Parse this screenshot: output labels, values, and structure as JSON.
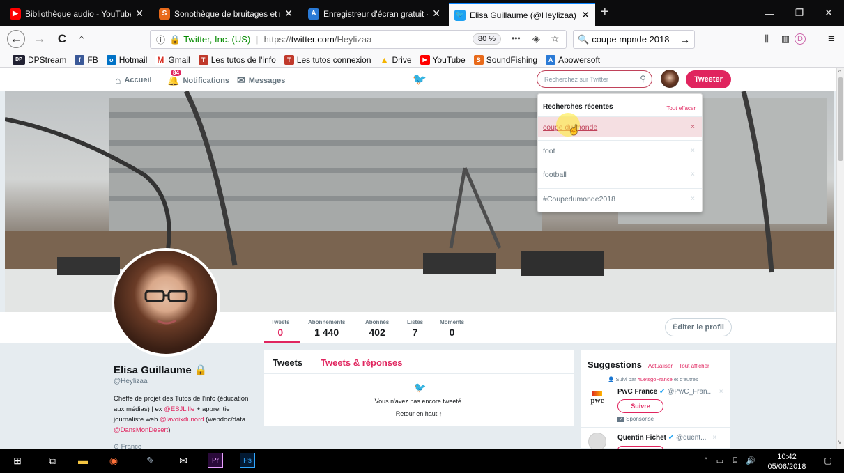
{
  "browser": {
    "tabs": [
      {
        "label": "Bibliothèque audio - YouTube",
        "close": "✕",
        "icon": "youtube-icon",
        "color": "#ff0000"
      },
      {
        "label": "Sonothèque de bruitages et mu",
        "close": "✕",
        "icon": "soundfishing-icon",
        "color": "#e86a1b"
      },
      {
        "label": "Enregistreur d'écran gratuit - en",
        "close": "✕",
        "icon": "apowersoft-icon",
        "color": "#2a7ad6"
      },
      {
        "label": "Elisa Guillaume (@Heylizaa) | Tw",
        "close": "✕",
        "icon": "twitter-icon",
        "color": "#1da1f2"
      }
    ],
    "new_tab": "+",
    "nav": {
      "back": "←",
      "forward": "→",
      "reload": "C",
      "home": "⌂",
      "site_identity": "Twitter, Inc. (US)",
      "url_prefix": "https://",
      "url_domain": "twitter.com",
      "url_path": "/Heylizaa",
      "zoom": "80 %",
      "more": "•••",
      "search_value": "coupe mpnde 2018",
      "search_go": "→"
    },
    "bookmarks": [
      {
        "label": "DPStream",
        "icon": "dpstream-icon",
        "badge": "DP",
        "color": "#223"
      },
      {
        "label": "FB",
        "icon": "facebook-icon",
        "badge": "f",
        "color": "#3b5998"
      },
      {
        "label": "Hotmail",
        "icon": "outlook-icon",
        "badge": "o",
        "color": "#0072c6"
      },
      {
        "label": "Gmail",
        "icon": "gmail-icon",
        "badge": "M",
        "color": "#ffffff"
      },
      {
        "label": "Les tutos de l'info",
        "icon": "tutos-icon",
        "badge": "T",
        "color": "#c0392b"
      },
      {
        "label": "Les tutos connexion",
        "icon": "tutos-connexion-icon",
        "badge": "T",
        "color": "#c0392b"
      },
      {
        "label": "Drive",
        "icon": "drive-icon",
        "badge": "▲",
        "color": "#f4b400"
      },
      {
        "label": "YouTube",
        "icon": "youtube-icon",
        "badge": "▶",
        "color": "#ff0000"
      },
      {
        "label": "SoundFishing",
        "icon": "soundfishing-icon",
        "badge": "S",
        "color": "#e86a1b"
      },
      {
        "label": "Apowersoft",
        "icon": "apowersoft-icon",
        "badge": "A",
        "color": "#2a7ad6"
      }
    ]
  },
  "twitter": {
    "nav": {
      "home": "Accueil",
      "notifications": "Notifications",
      "notif_count": "84",
      "messages": "Messages",
      "search_placeholder": "Recherchez sur Twitter",
      "tweet_button": "Tweeter"
    },
    "dropdown": {
      "title": "Recherches récentes",
      "clear_all": "Tout effacer",
      "items": [
        "coupe du monde",
        "foot",
        "football",
        "#Coupedumonde2018"
      ],
      "remove": "×"
    },
    "stats": [
      {
        "label": "Tweets",
        "value": "0"
      },
      {
        "label": "Abonnements",
        "value": "1 440"
      },
      {
        "label": "Abonnés",
        "value": "402"
      },
      {
        "label": "Listes",
        "value": "7"
      },
      {
        "label": "Moments",
        "value": "0"
      }
    ],
    "edit_profile": "Éditer le profil",
    "profile": {
      "name": "Elisa Guillaume",
      "handle": "@Heylizaa",
      "bio_1": "Cheffe de projet des Tutos de l'info (éducation aux médias) | ex ",
      "bio_link_1": "@ESJLille",
      "bio_2": " + apprentie journaliste web ",
      "bio_link_2": "@lavoixdunord",
      "bio_3": " (webdoc/data ",
      "bio_link_3": "@DansMonDesert",
      "bio_4": ")",
      "location": "France"
    },
    "timeline": {
      "tab_tweets": "Tweets",
      "tab_replies": "Tweets & réponses",
      "empty": "Vous n'avez pas encore tweeté.",
      "back_top": "Retour en haut ↑"
    },
    "suggestions": {
      "title": "Suggestions",
      "refresh": "· Actualiser",
      "show_all": "· Tout afficher",
      "followed_by_prefix": "Suivi par ",
      "followed_by_link": "#LetsgoFrance",
      "followed_by_suffix": " et d'autres",
      "user1_name": "PwC France",
      "user1_handle": "@PwC_Fran...",
      "user1_logo": "pwc",
      "follow": "Suivre",
      "sponsored": "Sponsorisé",
      "user2_name": "Quentin Fichet",
      "user2_handle": "@quent..."
    },
    "accent": "#e0245e"
  },
  "taskbar": {
    "time": "10:42",
    "date": "05/06/2018"
  }
}
